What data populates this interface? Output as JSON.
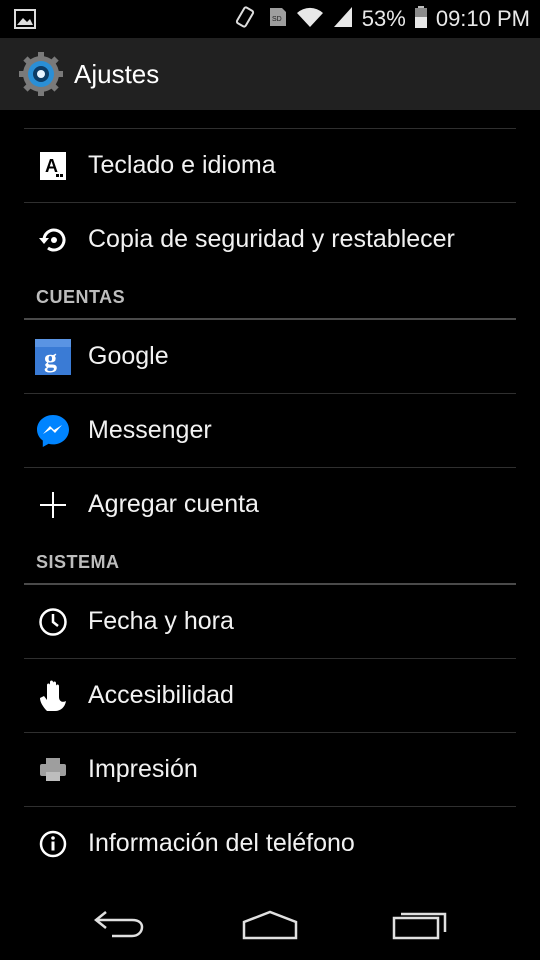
{
  "status_bar": {
    "battery_percent": "53%",
    "time": "09:10 PM",
    "icons": [
      "gallery-icon",
      "vibrate-icon",
      "sd-card-icon",
      "wifi-icon",
      "signal-icon",
      "battery-icon"
    ]
  },
  "action_bar": {
    "title": "Ajustes",
    "icon": "settings-gear-icon"
  },
  "items_top": [
    {
      "label": "Teclado e idioma",
      "icon": "keyboard-language-icon"
    },
    {
      "label": "Copia de seguridad y restablecer",
      "icon": "backup-restore-icon"
    }
  ],
  "sections": [
    {
      "header": "CUENTAS",
      "items": [
        {
          "label": "Google",
          "icon": "google-icon"
        },
        {
          "label": "Messenger",
          "icon": "messenger-icon"
        },
        {
          "label": "Agregar cuenta",
          "icon": "plus-icon"
        }
      ]
    },
    {
      "header": "SISTEMA",
      "items": [
        {
          "label": "Fecha y hora",
          "icon": "clock-icon"
        },
        {
          "label": "Accesibilidad",
          "icon": "hand-icon"
        },
        {
          "label": "Impresión",
          "icon": "printer-icon"
        },
        {
          "label": "Información del teléfono",
          "icon": "info-icon"
        }
      ]
    }
  ],
  "nav_bar": {
    "buttons": [
      "back-icon",
      "home-icon",
      "recents-icon"
    ]
  },
  "colors": {
    "background": "#000000",
    "action_bar": "#212121",
    "divider": "#2f2f2f",
    "section_text": "#bdbdbd",
    "google_blue": "#3a7bd5",
    "messenger_blue": "#0084ff"
  }
}
